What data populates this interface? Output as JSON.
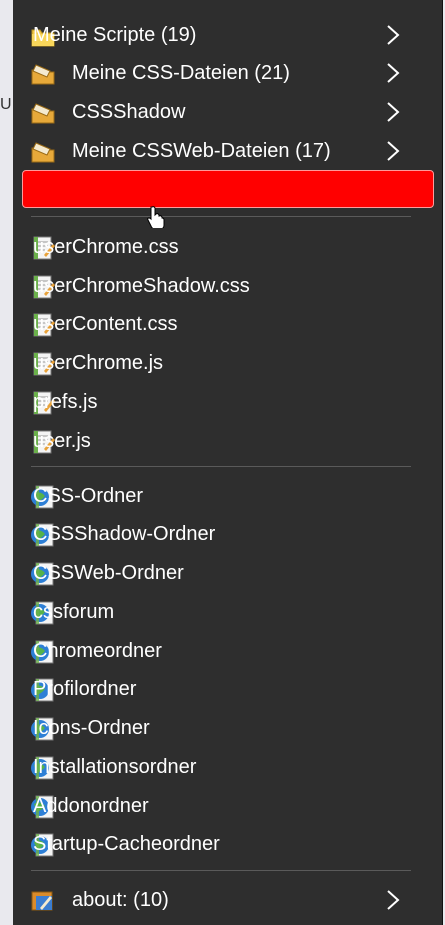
{
  "menu": {
    "submenus": [
      {
        "label": "Meine Scripte (19)",
        "icon": "folder-icon"
      },
      {
        "label": "Meine CSS-Dateien (21)",
        "icon": "script-folder-icon"
      },
      {
        "label": "CSSShadow",
        "icon": "script-folder-icon"
      },
      {
        "label": "Meine CSSWeb-Dateien (17)",
        "icon": "script-folder-icon"
      }
    ],
    "files": [
      {
        "label": "userChrome.css"
      },
      {
        "label": "userChromeShadow.css"
      },
      {
        "label": "userContent.css"
      },
      {
        "label": "userChrome.js"
      },
      {
        "label": "prefs.js"
      },
      {
        "label": "user.js"
      }
    ],
    "folders": [
      {
        "label": "CSS-Ordner"
      },
      {
        "label": "CSSShadow-Ordner"
      },
      {
        "label": "CSSWeb-Ordner"
      },
      {
        "label": "cssforum"
      },
      {
        "label": "Chromeordner"
      },
      {
        "label": "Profilordner"
      },
      {
        "label": "Icons-Ordner"
      },
      {
        "label": "Installationsordner"
      },
      {
        "label": "Addonordner"
      },
      {
        "label": "Startup-Cacheordner"
      }
    ],
    "about": {
      "label": "about: (10)"
    },
    "highlight_color": "#ff0000"
  },
  "background": {
    "partial_letter": "U"
  }
}
